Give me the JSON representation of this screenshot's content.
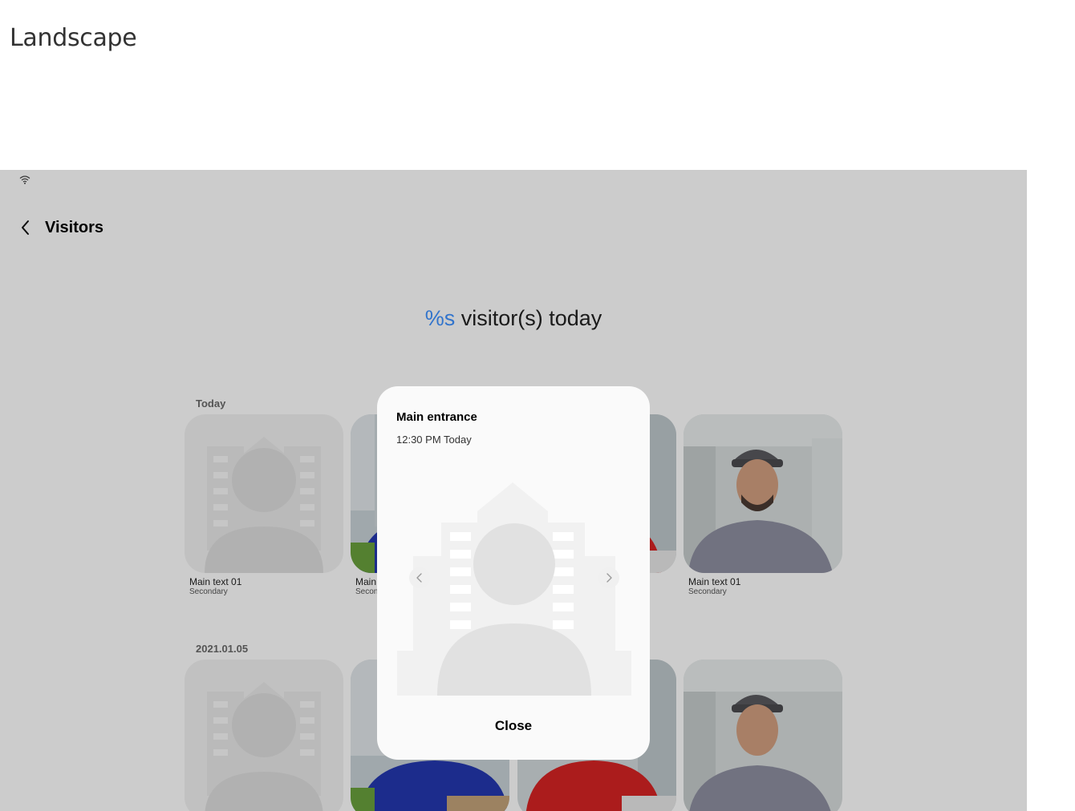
{
  "page": {
    "heading": "Landscape"
  },
  "appbar": {
    "title": "Visitors"
  },
  "summary": {
    "count": "%s",
    "suffix": "visitor(s) today"
  },
  "sections": [
    {
      "label": "Today",
      "items": [
        {
          "main": "Main text 01",
          "secondary": "Secondary",
          "image": "placeholder-avatar"
        },
        {
          "main": "Main",
          "secondary": "Secon",
          "image": "visitor-blue-uniform"
        },
        {
          "main": "",
          "secondary": "",
          "image": "visitor-red-uniform"
        },
        {
          "main": "Main text 01",
          "secondary": "Secondary",
          "image": "visitor-grey-cap"
        }
      ]
    },
    {
      "label": "2021.01.05",
      "items": [
        {
          "image": "placeholder-avatar"
        },
        {
          "image": "visitor-blue-uniform"
        },
        {
          "image": "visitor-red-uniform"
        },
        {
          "image": "visitor-grey-cap"
        }
      ]
    }
  ],
  "dialog": {
    "title": "Main entrance",
    "time": "12:30 PM Today",
    "close_label": "Close",
    "image": "placeholder-avatar"
  },
  "colors": {
    "accent": "#3e91ff",
    "background": "#ffffff",
    "dim_overlay": "#cbcbcb",
    "dialog": "#fafafa"
  }
}
